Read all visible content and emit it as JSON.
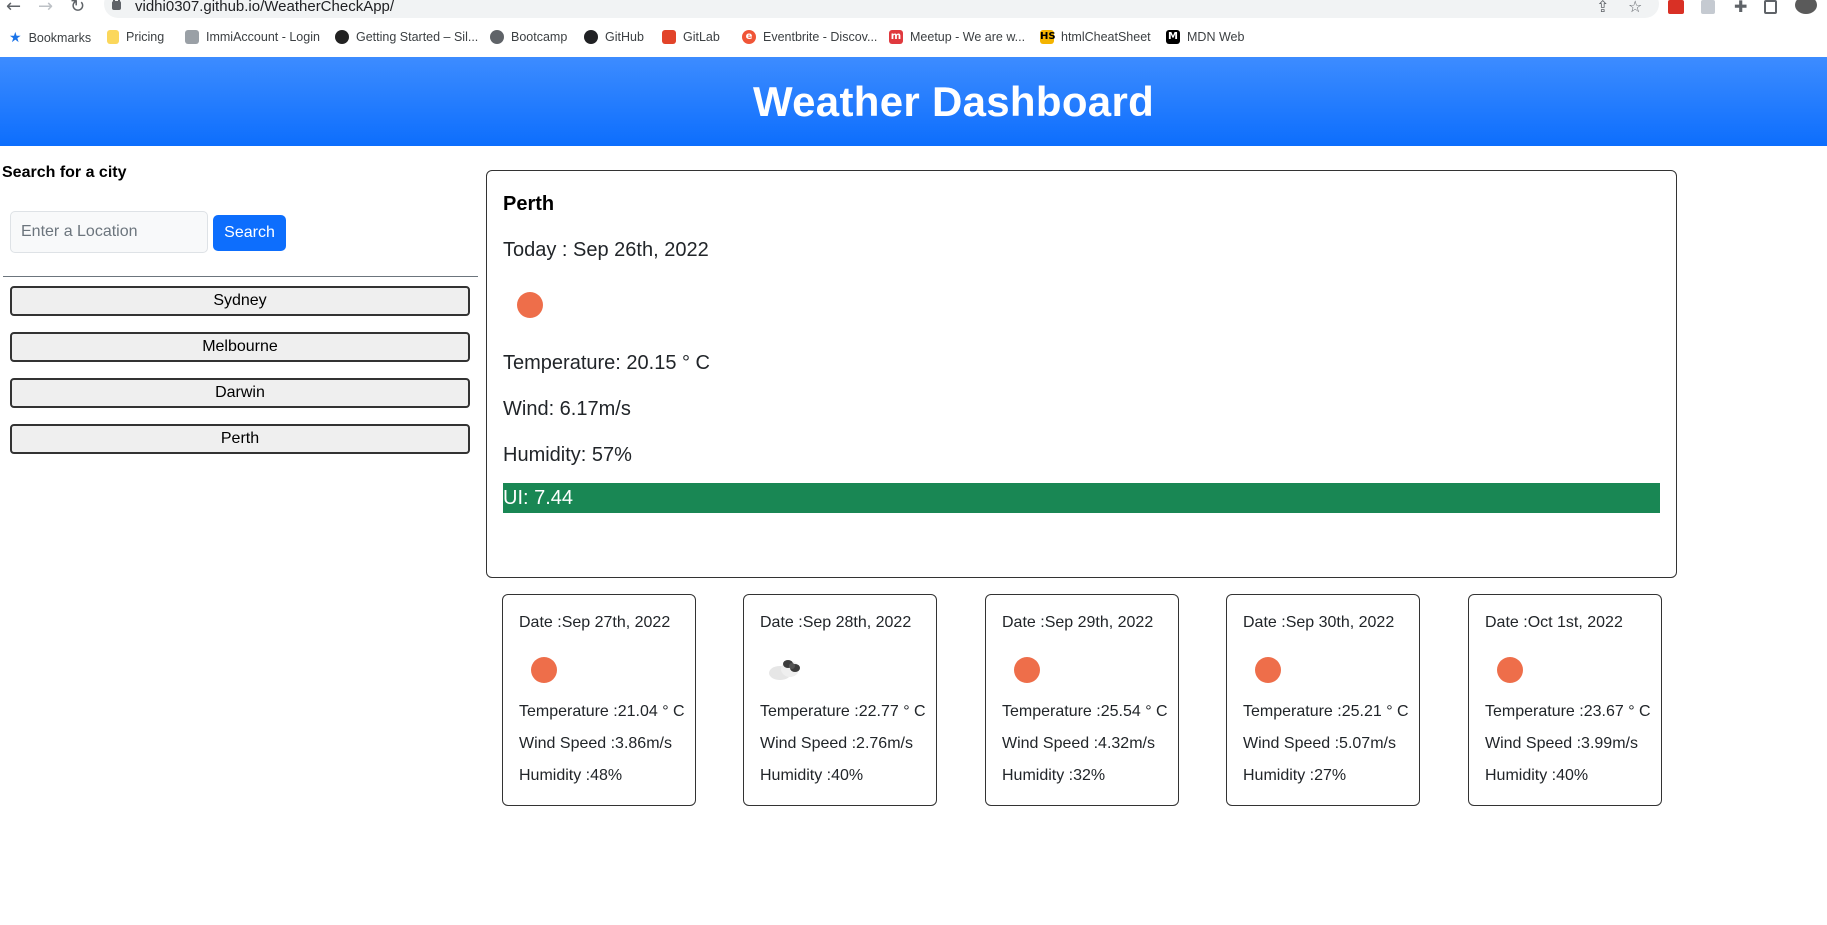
{
  "browser": {
    "url": "vidhi0307.github.io/WeatherCheckApp/",
    "bookmarks": [
      {
        "label": "Bookmarks",
        "icon": "star-icon",
        "color": "#1a73e8"
      },
      {
        "label": "Pricing",
        "icon": "folder-icon",
        "color": "#fbc02d"
      },
      {
        "label": "ImmiAccount - Login",
        "icon": "crest-icon",
        "color": "#5f6368"
      },
      {
        "label": "Getting Started – Sil...",
        "icon": "silverstripe-icon",
        "color": "#222222"
      },
      {
        "label": "Bootcamp",
        "icon": "globe-icon",
        "color": "#5f6368"
      },
      {
        "label": "GitHub",
        "icon": "github-icon",
        "color": "#202124"
      },
      {
        "label": "GitLab",
        "icon": "gitlab-icon",
        "color": "#e24329"
      },
      {
        "label": "Eventbrite - Discov...",
        "icon": "eventbrite-icon",
        "color": "#f05537"
      },
      {
        "label": "Meetup - We are w...",
        "icon": "meetup-icon",
        "color": "#e0393e"
      },
      {
        "label": "htmlCheatSheet",
        "icon": "htmlcheatsheet-icon",
        "color": "#f4b400"
      },
      {
        "label": "MDN Web",
        "icon": "mdn-icon",
        "color": "#000000"
      }
    ]
  },
  "header": {
    "title": "Weather Dashboard"
  },
  "sidebar": {
    "search_title": "Search for a city",
    "search_placeholder": "Enter a Location",
    "search_button": "Search",
    "history": [
      "Sydney",
      "Melbourne",
      "Darwin",
      "Perth"
    ]
  },
  "current": {
    "city": "Perth",
    "date": "Today : Sep 26th, 2022",
    "icon": "sun-icon",
    "temperature": "Temperature: 20.15 ° C",
    "wind": "Wind: 6.17m/s",
    "humidity": "Humidity: 57%",
    "uv": "UI: 7.44",
    "uv_color": "#198754"
  },
  "forecast": [
    {
      "date": "Date :Sep 27th, 2022",
      "icon": "sun-icon",
      "temperature": "Temperature :21.04 ° C",
      "wind": "Wind Speed :3.86m/s",
      "humidity": "Humidity :48%"
    },
    {
      "date": "Date :Sep 28th, 2022",
      "icon": "cloud-icon",
      "temperature": "Temperature :22.77 ° C",
      "wind": "Wind Speed :2.76m/s",
      "humidity": "Humidity :40%"
    },
    {
      "date": "Date :Sep 29th, 2022",
      "icon": "sun-icon",
      "temperature": "Temperature :25.54 ° C",
      "wind": "Wind Speed :4.32m/s",
      "humidity": "Humidity :32%"
    },
    {
      "date": "Date :Sep 30th, 2022",
      "icon": "sun-icon",
      "temperature": "Temperature :25.21 ° C",
      "wind": "Wind Speed :5.07m/s",
      "humidity": "Humidity :27%"
    },
    {
      "date": "Date :Oct 1st, 2022",
      "icon": "sun-icon",
      "temperature": "Temperature :23.67 ° C",
      "wind": "Wind Speed :3.99m/s",
      "humidity": "Humidity :40%"
    }
  ],
  "colors": {
    "brand": "#0d6efd",
    "sun": "#ee6e4a"
  }
}
